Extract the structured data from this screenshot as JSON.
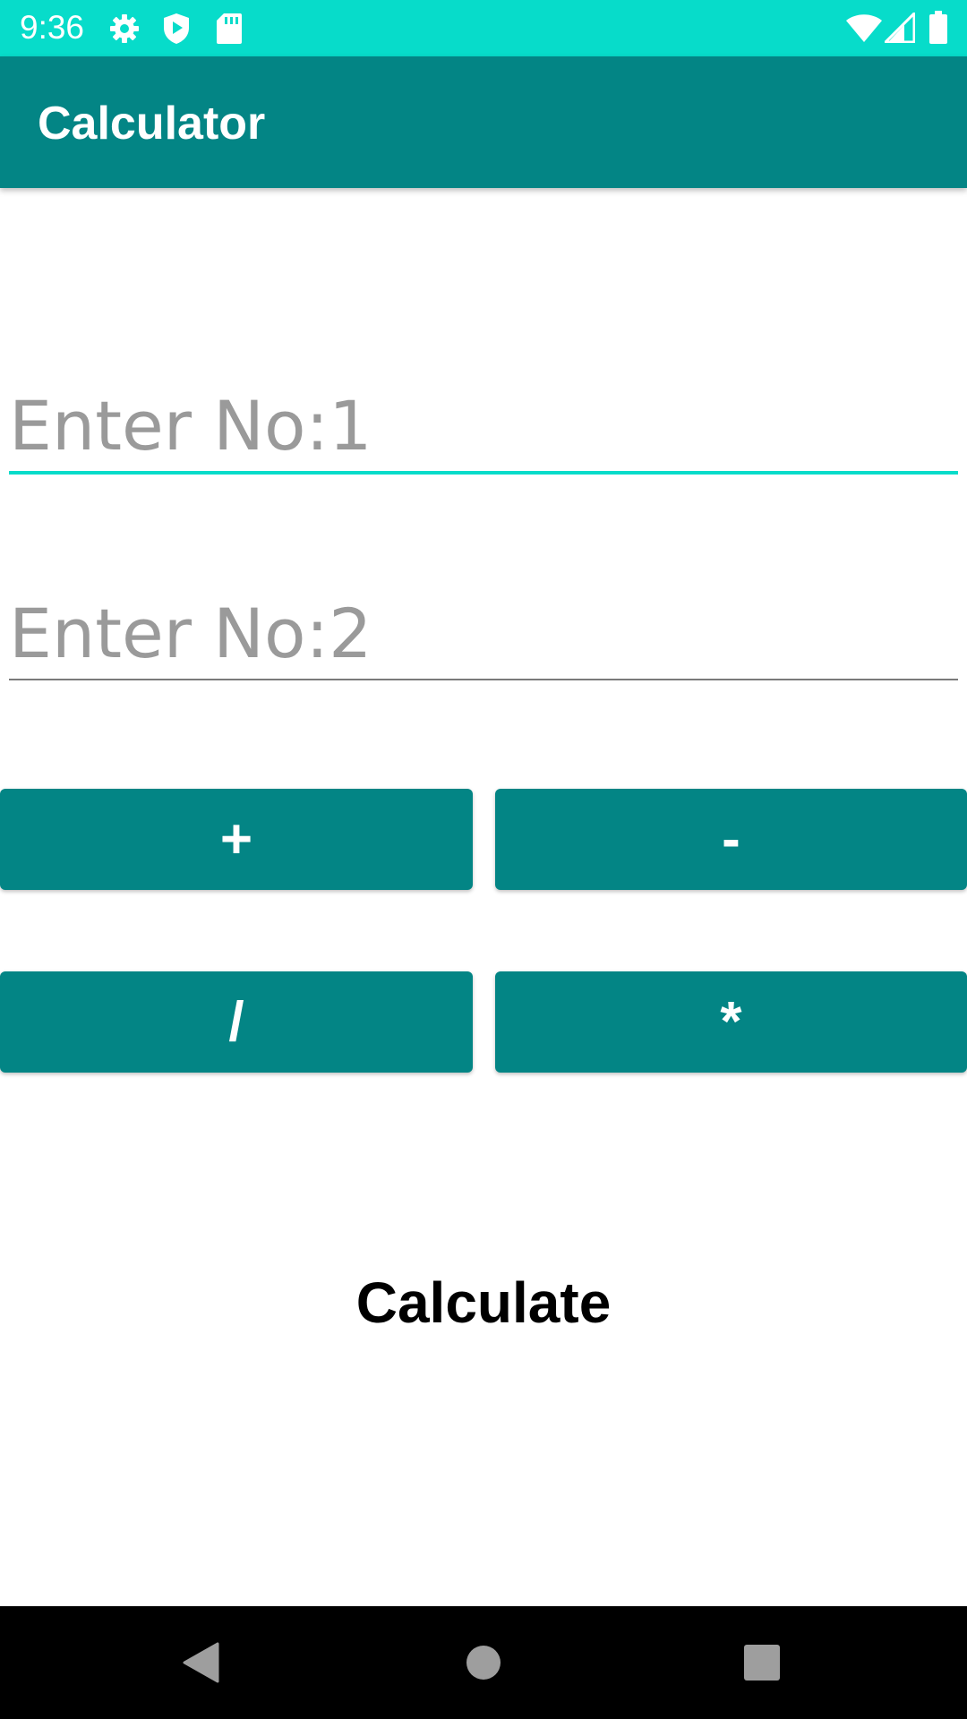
{
  "status_bar": {
    "time": "9:36",
    "left_icons": [
      "settings-icon",
      "shield-play-icon",
      "sd-card-icon"
    ],
    "right_icons": [
      "wifi-icon",
      "signal-icon",
      "battery-icon"
    ],
    "color": "#07dcca"
  },
  "app_bar": {
    "title": "Calculator",
    "color": "#038585"
  },
  "inputs": {
    "number1": {
      "value": "",
      "placeholder": "Enter No:1",
      "focused": true
    },
    "number2": {
      "value": "",
      "placeholder": "Enter No:2",
      "focused": false
    }
  },
  "operations": {
    "add_label": "+",
    "subtract_label": "-",
    "divide_label": "/",
    "multiply_label": "*"
  },
  "calculate": {
    "label": "Calculate"
  },
  "colors": {
    "accent": "#07dcca",
    "primary": "#038585"
  },
  "nav_bar": {
    "icons": [
      "back-icon",
      "home-icon",
      "recents-icon"
    ]
  }
}
